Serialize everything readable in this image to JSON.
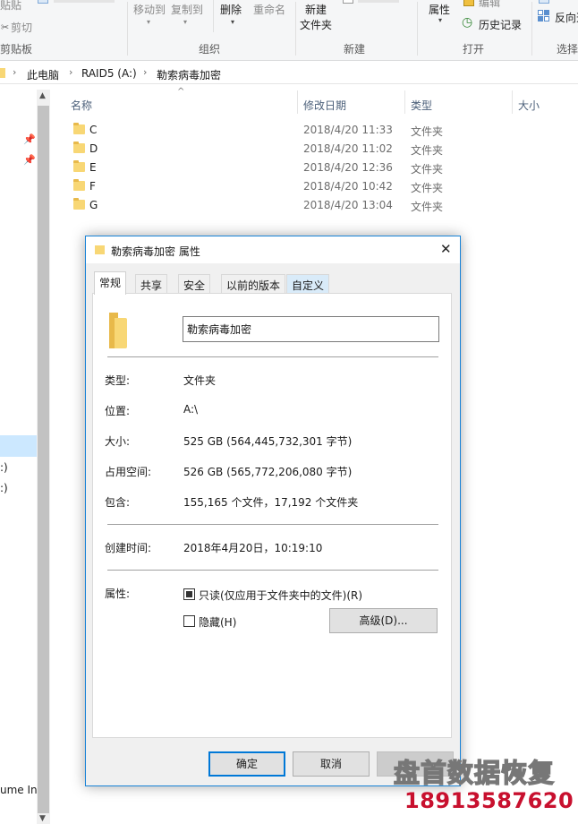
{
  "ribbon": {
    "clipboard": {
      "paste": "贴贴",
      "cut": "剪切",
      "group": "剪贴板"
    },
    "organize": {
      "move_to": "移动到",
      "copy_to": "复制到",
      "delete": "删除",
      "rename": "重命名",
      "group": "组织"
    },
    "new": {
      "new_folder_line1": "新建",
      "new_folder_line2": "文件夹",
      "group": "新建"
    },
    "open": {
      "properties": "属性",
      "edit": "编辑",
      "history": "历史记录",
      "group": "打开"
    },
    "select": {
      "invert": "反向选",
      "group": "选择"
    }
  },
  "address": {
    "crumbs": [
      "此电脑",
      "RAID5 (A:)",
      "勒索病毒加密"
    ]
  },
  "nav": {
    "items": [
      ":)",
      ":)",
      "ume In"
    ]
  },
  "list": {
    "columns": {
      "name": "名称",
      "date": "修改日期",
      "type": "类型",
      "size": "大小"
    },
    "rows": [
      {
        "name": "C",
        "date": "2018/4/20 11:33",
        "type": "文件夹"
      },
      {
        "name": "D",
        "date": "2018/4/20 11:02",
        "type": "文件夹"
      },
      {
        "name": "E",
        "date": "2018/4/20 12:36",
        "type": "文件夹"
      },
      {
        "name": "F",
        "date": "2018/4/20 10:42",
        "type": "文件夹"
      },
      {
        "name": "G",
        "date": "2018/4/20 13:04",
        "type": "文件夹"
      }
    ]
  },
  "dialog": {
    "title": "勒索病毒加密 属性",
    "tabs": [
      "常规",
      "共享",
      "安全",
      "以前的版本",
      "自定义"
    ],
    "folder_name": "勒索病毒加密",
    "props": {
      "type_label": "类型:",
      "type_value": "文件夹",
      "location_label": "位置:",
      "location_value": "A:\\",
      "size_label": "大小:",
      "size_value": "525 GB (564,445,732,301 字节)",
      "disk_label": "占用空间:",
      "disk_value": "526 GB (565,772,206,080 字节)",
      "contains_label": "包含:",
      "contains_value": "155,165 个文件，17,192 个文件夹",
      "created_label": "创建时间:",
      "created_value": "2018年4月20日，10:19:10",
      "attr_label": "属性:",
      "readonly_label": "只读(仅应用于文件夹中的文件)(R)",
      "hidden_label": "隐藏(H)",
      "advanced_button": "高级(D)..."
    },
    "buttons": {
      "ok": "确定",
      "cancel": "取消"
    },
    "close_glyph": "✕"
  },
  "watermark": {
    "brand": "盘首数据恢复",
    "phone": "18913587620"
  },
  "colors": {
    "accent": "#0078d7",
    "folder": "#f8d775",
    "watermark_phone": "#c8102e"
  }
}
